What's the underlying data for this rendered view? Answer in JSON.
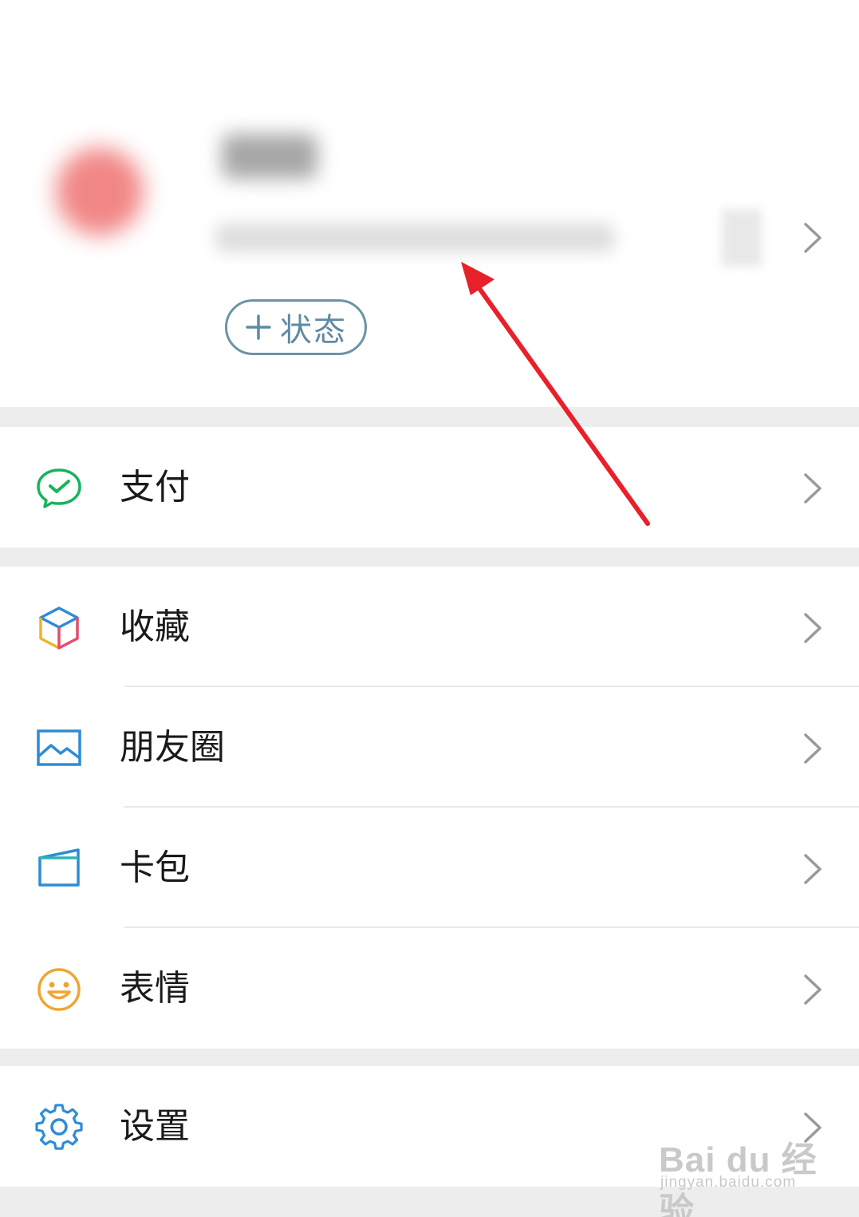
{
  "profile": {
    "status_button_label": "状态"
  },
  "menu": {
    "pay": "支付",
    "favorites": "收藏",
    "moments": "朋友圈",
    "card_pack": "卡包",
    "stickers": "表情",
    "settings": "设置"
  },
  "icons": {
    "pay": "wechat-pay-icon",
    "favorites": "cube-icon",
    "moments": "image-icon",
    "card_pack": "card-icon",
    "stickers": "smiley-icon",
    "settings": "gear-icon",
    "chevron": "chevron-right-icon"
  },
  "colors": {
    "pay_green": "#19b35c",
    "moments_blue": "#2f8bd6",
    "stickers_orange": "#f0a531",
    "settings_blue": "#2f8bd6",
    "annotation_red": "#e8202a",
    "status_blue": "#5f8ba3"
  },
  "watermark": {
    "main": "Bai du 经验",
    "sub": "jingyan.baidu.com"
  }
}
